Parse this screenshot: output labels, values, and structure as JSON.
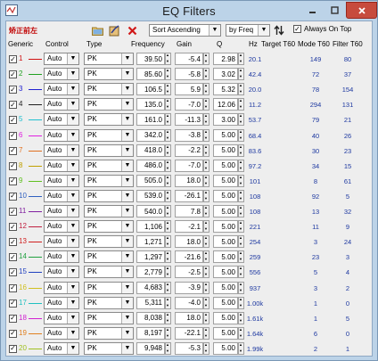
{
  "window": {
    "title": "EQ Filters"
  },
  "toolbar": {
    "label": "矫正前左",
    "sort_select": "Sort Ascending",
    "sort_by_select": "by Freq",
    "always_on_top_label": "Always On Top",
    "always_on_top_checked": true
  },
  "columns": {
    "generic": "Generic",
    "control": "Control",
    "type": "Type",
    "frequency": "Frequency",
    "gain": "Gain",
    "q": "Q",
    "hz": "Hz",
    "target_t60": "Target T60",
    "mode_t60": "Mode T60",
    "filter_t60": "Filter T60"
  },
  "filters": [
    {
      "index": "1",
      "color": "#d01010",
      "control": "Auto",
      "type": "PK",
      "frequency": "39.50",
      "gain": "-5.4",
      "q": "2.98",
      "hz": "20.1",
      "target_t60": "",
      "mode_t60": "149",
      "filter_t60": "80"
    },
    {
      "index": "2",
      "color": "#20a020",
      "control": "Auto",
      "type": "PK",
      "frequency": "85.60",
      "gain": "-5.8",
      "q": "3.02",
      "hz": "42.4",
      "target_t60": "",
      "mode_t60": "72",
      "filter_t60": "37"
    },
    {
      "index": "3",
      "color": "#2020d0",
      "control": "Auto",
      "type": "PK",
      "frequency": "106.5",
      "gain": "5.9",
      "q": "5.32",
      "hz": "20.0",
      "target_t60": "",
      "mode_t60": "78",
      "filter_t60": "154"
    },
    {
      "index": "4",
      "color": "#202020",
      "control": "Auto",
      "type": "PK",
      "frequency": "135.0",
      "gain": "-7.0",
      "q": "12.06",
      "hz": "11.2",
      "target_t60": "",
      "mode_t60": "294",
      "filter_t60": "131"
    },
    {
      "index": "5",
      "color": "#20c0d0",
      "control": "Auto",
      "type": "PK",
      "frequency": "161.0",
      "gain": "-11.3",
      "q": "3.00",
      "hz": "53.7",
      "target_t60": "",
      "mode_t60": "79",
      "filter_t60": "21"
    },
    {
      "index": "6",
      "color": "#e020e0",
      "control": "Auto",
      "type": "PK",
      "frequency": "342.0",
      "gain": "-3.8",
      "q": "5.00",
      "hz": "68.4",
      "target_t60": "",
      "mode_t60": "40",
      "filter_t60": "26"
    },
    {
      "index": "7",
      "color": "#e07020",
      "control": "Auto",
      "type": "PK",
      "frequency": "418.0",
      "gain": "-2.2",
      "q": "5.00",
      "hz": "83.6",
      "target_t60": "",
      "mode_t60": "30",
      "filter_t60": "23"
    },
    {
      "index": "8",
      "color": "#c0a000",
      "control": "Auto",
      "type": "PK",
      "frequency": "486.0",
      "gain": "-7.0",
      "q": "5.00",
      "hz": "97.2",
      "target_t60": "",
      "mode_t60": "34",
      "filter_t60": "15"
    },
    {
      "index": "9",
      "color": "#60c020",
      "control": "Auto",
      "type": "PK",
      "frequency": "505.0",
      "gain": "18.0",
      "q": "5.00",
      "hz": "101",
      "target_t60": "",
      "mode_t60": "8",
      "filter_t60": "61"
    },
    {
      "index": "10",
      "color": "#3060c0",
      "control": "Auto",
      "type": "PK",
      "frequency": "539.0",
      "gain": "-26.1",
      "q": "5.00",
      "hz": "108",
      "target_t60": "",
      "mode_t60": "92",
      "filter_t60": "5"
    },
    {
      "index": "11",
      "color": "#8020a0",
      "control": "Auto",
      "type": "PK",
      "frequency": "540.0",
      "gain": "7.8",
      "q": "5.00",
      "hz": "108",
      "target_t60": "",
      "mode_t60": "13",
      "filter_t60": "32"
    },
    {
      "index": "12",
      "color": "#c02040",
      "control": "Auto",
      "type": "PK",
      "frequency": "1,106",
      "gain": "-2.1",
      "q": "5.00",
      "hz": "221",
      "target_t60": "",
      "mode_t60": "11",
      "filter_t60": "9"
    },
    {
      "index": "13",
      "color": "#d02020",
      "control": "Auto",
      "type": "PK",
      "frequency": "1,271",
      "gain": "18.0",
      "q": "5.00",
      "hz": "254",
      "target_t60": "",
      "mode_t60": "3",
      "filter_t60": "24"
    },
    {
      "index": "14",
      "color": "#20a040",
      "control": "Auto",
      "type": "PK",
      "frequency": "1,297",
      "gain": "-21.6",
      "q": "5.00",
      "hz": "259",
      "target_t60": "",
      "mode_t60": "23",
      "filter_t60": "3"
    },
    {
      "index": "15",
      "color": "#2040c0",
      "control": "Auto",
      "type": "PK",
      "frequency": "2,779",
      "gain": "-2.5",
      "q": "5.00",
      "hz": "556",
      "target_t60": "",
      "mode_t60": "5",
      "filter_t60": "4"
    },
    {
      "index": "16",
      "color": "#d0c020",
      "control": "Auto",
      "type": "PK",
      "frequency": "4,683",
      "gain": "-3.9",
      "q": "5.00",
      "hz": "937",
      "target_t60": "",
      "mode_t60": "3",
      "filter_t60": "2"
    },
    {
      "index": "17",
      "color": "#20c0c0",
      "control": "Auto",
      "type": "PK",
      "frequency": "5,311",
      "gain": "-4.0",
      "q": "5.00",
      "hz": "1.00k",
      "target_t60": "",
      "mode_t60": "1",
      "filter_t60": "0"
    },
    {
      "index": "18",
      "color": "#d020d0",
      "control": "Auto",
      "type": "PK",
      "frequency": "8,038",
      "gain": "18.0",
      "q": "5.00",
      "hz": "1.61k",
      "target_t60": "",
      "mode_t60": "1",
      "filter_t60": "5"
    },
    {
      "index": "19",
      "color": "#e08020",
      "control": "Auto",
      "type": "PK",
      "frequency": "8,197",
      "gain": "-22.1",
      "q": "5.00",
      "hz": "1.64k",
      "target_t60": "",
      "mode_t60": "6",
      "filter_t60": "0"
    },
    {
      "index": "20",
      "color": "#a0c020",
      "control": "Auto",
      "type": "PK",
      "frequency": "9,948",
      "gain": "-5.3",
      "q": "5.00",
      "hz": "1.99k",
      "target_t60": "",
      "mode_t60": "2",
      "filter_t60": "1"
    }
  ]
}
